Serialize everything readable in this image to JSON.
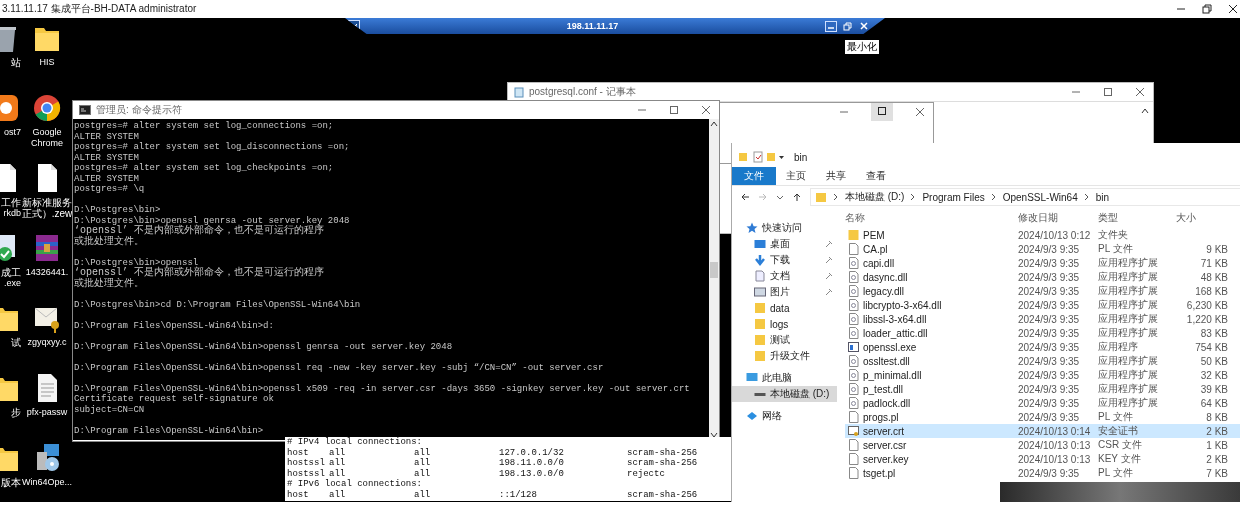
{
  "session_bar": {
    "title": "3.11.11.17 集成平台-BH-DATA administrator"
  },
  "remote_bar": {
    "host": "198.11.11.17",
    "tooltip": "最小化"
  },
  "desktop_icons": {
    "column_1": [
      {
        "lines": [
          "站"
        ],
        "kind": "recycle"
      },
      {
        "lines": [
          "ost7"
        ],
        "kind": "app"
      },
      {
        "lines": [
          "工作",
          "rkdb"
        ],
        "kind": "file"
      },
      {
        "lines": [
          "成工",
          ".exe"
        ],
        "kind": "check"
      },
      {
        "lines": [
          "试"
        ],
        "kind": "folder"
      },
      {
        "lines": [
          "步"
        ],
        "kind": "folder"
      },
      {
        "lines": [
          "版本"
        ],
        "kind": "folder"
      }
    ],
    "column_2": [
      {
        "lines": [
          "HIS"
        ],
        "kind": "folder"
      },
      {
        "lines": [
          "Google",
          "Chrome"
        ],
        "kind": "chrome"
      },
      {
        "lines": [
          "新标准服务",
          "正式）.zew"
        ],
        "kind": "file"
      },
      {
        "lines": [
          "14326441."
        ],
        "kind": "archive"
      },
      {
        "lines": [
          "zgyqxyy.c"
        ],
        "kind": "certificate"
      },
      {
        "lines": [
          "pfx-passw"
        ],
        "kind": "document"
      },
      {
        "lines": [
          "Win64Ope..."
        ],
        "kind": "installer"
      }
    ]
  },
  "notepad": {
    "title": "postgresql.conf - 记事本"
  },
  "middle_window": {
    "maximize_highlighted": true
  },
  "cmd": {
    "title": "管理员: 命令提示符",
    "blocks": [
      [
        "postgres=# alter system set log_connections =on;",
        "ALTER SYSTEM",
        "postgres=# alter system set log_disconnections =on;",
        "ALTER SYSTEM",
        "postgres=# alter system set log_checkpoints =on;",
        "ALTER SYSTEM",
        "postgres=# \\q"
      ],
      [
        "D:\\Postgres\\bin>",
        "D:\\Postgres\\bin>openssl genrsa -out server.key 2048",
        "‘openssl’ 不是内部或外部命令，也不是可运行的程序",
        "或批处理文件。"
      ],
      [
        "D:\\Postgres\\bin>openssl",
        "‘openssl’ 不是内部或外部命令，也不是可运行的程序",
        "或批处理文件。"
      ],
      [
        "D:\\Postgres\\bin>cd D:\\Program Files\\OpenSSL-Win64\\bin"
      ],
      [
        "D:\\Program Files\\OpenSSL-Win64\\bin>d:"
      ],
      [
        "D:\\Program Files\\OpenSSL-Win64\\bin>openssl genrsa -out server.key 2048"
      ],
      [
        "D:\\Program Files\\OpenSSL-Win64\\bin>openssl req -new -key server.key -subj “/CN=CN” -out server.csr"
      ],
      [
        "D:\\Program Files\\OpenSSL-Win64\\bin>openssl x509 -req -in server.csr -days 3650 -signkey server.key -out server.crt",
        "Certificate request self-signature ok",
        "subject=CN=CN"
      ],
      [
        "D:\\Program Files\\OpenSSL-Win64\\bin>"
      ]
    ]
  },
  "config_text": {
    "rows": [
      {
        "kind": "comment",
        "text": "# IPv4 local connections:"
      },
      {
        "kind": "entry",
        "cells": [
          "host",
          "all",
          "all",
          "127.0.0.1/32",
          "scram-sha-256"
        ]
      },
      {
        "kind": "entry",
        "cells": [
          "hostssl",
          "all",
          "all",
          "198.11.0.0/0",
          "scram-sha-256"
        ]
      },
      {
        "kind": "entry",
        "cells": [
          "hostssl",
          "all",
          "all",
          "198.13.0.0/0",
          "rejectc"
        ]
      },
      {
        "kind": "comment",
        "text": "# IPv6 local connections:"
      },
      {
        "kind": "entry",
        "cells": [
          "host",
          "all",
          "all",
          "::1/128",
          "scram-sha-256"
        ]
      }
    ]
  },
  "explorer": {
    "title": "bin",
    "ribbon_tabs": [
      {
        "label": "文件",
        "selected": true
      },
      {
        "label": "主页",
        "selected": false
      },
      {
        "label": "共享",
        "selected": false
      },
      {
        "label": "查看",
        "selected": false
      }
    ],
    "breadcrumb": [
      "本地磁盘 (D:)",
      "Program Files",
      "OpenSSL-Win64",
      "bin"
    ],
    "nav": [
      {
        "label": "快速访问",
        "kind": "star",
        "pinned": false,
        "selected": false,
        "children": [
          {
            "label": "桌面",
            "kind": "desktop",
            "pinned": true,
            "selected": false
          },
          {
            "label": "下载",
            "kind": "download",
            "pinned": true,
            "selected": false
          },
          {
            "label": "文档",
            "kind": "document",
            "pinned": true,
            "selected": false
          },
          {
            "label": "图片",
            "kind": "picture",
            "pinned": true,
            "selected": false
          },
          {
            "label": "data",
            "kind": "folder",
            "pinned": false,
            "selected": false
          },
          {
            "label": "logs",
            "kind": "folder",
            "pinned": false,
            "selected": false
          },
          {
            "label": "测试",
            "kind": "folder",
            "pinned": false,
            "selected": false
          },
          {
            "label": "升级文件",
            "kind": "folder",
            "pinned": false,
            "selected": false
          }
        ]
      },
      {
        "label": "此电脑",
        "kind": "pc",
        "pinned": false,
        "selected": false,
        "children": [
          {
            "label": "本地磁盘 (D:)",
            "kind": "drive",
            "pinned": false,
            "selected": true
          }
        ]
      },
      {
        "label": "网络",
        "kind": "network",
        "pinned": false,
        "selected": false
      }
    ],
    "columns": [
      "名称",
      "修改日期",
      "类型",
      "大小"
    ],
    "files": [
      {
        "name": "PEM",
        "date": "2024/10/13 0:12",
        "type": "文件夹",
        "kind": "folder",
        "selected": false
      },
      {
        "name": "CA.pl",
        "date": "2024/9/3 9:35",
        "type": "PL 文件",
        "size": "9 KB",
        "kind": "file",
        "selected": false
      },
      {
        "name": "capi.dll",
        "date": "2024/9/3 9:35",
        "type": "应用程序扩展",
        "size": "71 KB",
        "kind": "dll",
        "selected": false
      },
      {
        "name": "dasync.dll",
        "date": "2024/9/3 9:35",
        "type": "应用程序扩展",
        "size": "48 KB",
        "kind": "dll",
        "selected": false
      },
      {
        "name": "legacy.dll",
        "date": "2024/9/3 9:35",
        "type": "应用程序扩展",
        "size": "168 KB",
        "kind": "dll",
        "selected": false
      },
      {
        "name": "libcrypto-3-x64.dll",
        "date": "2024/9/3 9:35",
        "type": "应用程序扩展",
        "size": "6,230 KB",
        "kind": "dll",
        "selected": false
      },
      {
        "name": "libssl-3-x64.dll",
        "date": "2024/9/3 9:35",
        "type": "应用程序扩展",
        "size": "1,220 KB",
        "kind": "dll",
        "selected": false
      },
      {
        "name": "loader_attic.dll",
        "date": "2024/9/3 9:35",
        "type": "应用程序扩展",
        "size": "83 KB",
        "kind": "dll",
        "selected": false
      },
      {
        "name": "openssl.exe",
        "date": "2024/9/3 9:35",
        "type": "应用程序",
        "size": "754 KB",
        "kind": "exe",
        "selected": false
      },
      {
        "name": "ossltest.dll",
        "date": "2024/9/3 9:35",
        "type": "应用程序扩展",
        "size": "50 KB",
        "kind": "dll",
        "selected": false
      },
      {
        "name": "p_minimal.dll",
        "date": "2024/9/3 9:35",
        "type": "应用程序扩展",
        "size": "32 KB",
        "kind": "dll",
        "selected": false
      },
      {
        "name": "p_test.dll",
        "date": "2024/9/3 9:35",
        "type": "应用程序扩展",
        "size": "39 KB",
        "kind": "dll",
        "selected": false
      },
      {
        "name": "padlock.dll",
        "date": "2024/9/3 9:35",
        "type": "应用程序扩展",
        "size": "64 KB",
        "kind": "dll",
        "selected": false
      },
      {
        "name": "progs.pl",
        "date": "2024/9/3 9:35",
        "type": "PL 文件",
        "size": "8 KB",
        "kind": "file",
        "selected": false
      },
      {
        "name": "server.crt",
        "date": "2024/10/13 0:14",
        "type": "安全证书",
        "size": "2 KB",
        "kind": "certificate",
        "selected": true
      },
      {
        "name": "server.csr",
        "date": "2024/10/13 0:13",
        "type": "CSR 文件",
        "size": "1 KB",
        "kind": "file",
        "selected": false
      },
      {
        "name": "server.key",
        "date": "2024/10/13 0:13",
        "type": "KEY 文件",
        "size": "2 KB",
        "kind": "file",
        "selected": false
      },
      {
        "name": "tsget.pl",
        "date": "2024/9/3 9:35",
        "type": "PL 文件",
        "size": "7 KB",
        "kind": "file",
        "selected": false
      }
    ]
  }
}
